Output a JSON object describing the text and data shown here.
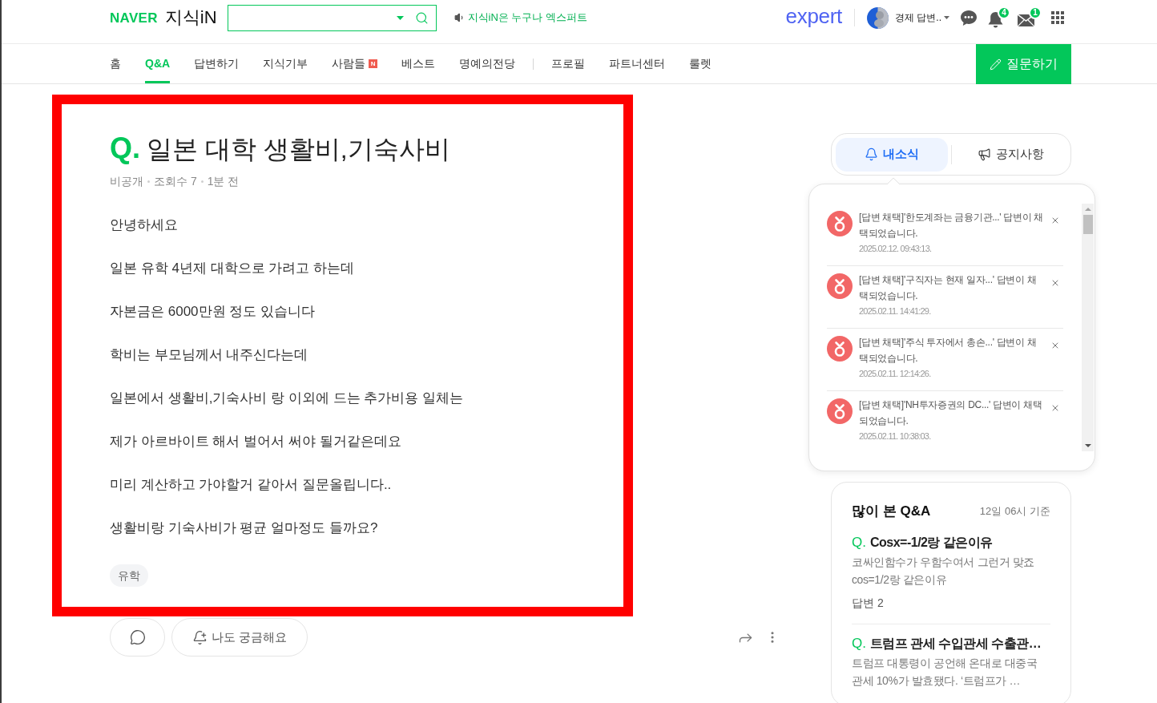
{
  "header": {
    "brand_logo": "NAVER",
    "service_logo": "지식iN",
    "notice_link": "지식iN은 누구나 엑스퍼트",
    "expert_logo": "expert",
    "user_name": "경제 답변..",
    "notifications_badge": "4",
    "mail_badge": "1"
  },
  "nav": {
    "groups": [
      {
        "items": [
          {
            "label": "홈",
            "selected": false
          },
          {
            "label": "Q&A",
            "selected": true
          },
          {
            "label": "답변하기",
            "selected": false
          },
          {
            "label": "지식기부",
            "selected": false
          },
          {
            "label": "사람들",
            "selected": false,
            "badge": "N"
          },
          {
            "label": "베스트",
            "selected": false
          },
          {
            "label": "명예의전당",
            "selected": false
          }
        ]
      },
      {
        "items": [
          {
            "label": "프로필",
            "selected": false
          },
          {
            "label": "파트너센터",
            "selected": false
          },
          {
            "label": "룰렛",
            "selected": false
          }
        ]
      }
    ],
    "ask_button": "질문하기"
  },
  "question": {
    "mark": "Q.",
    "title": "일본 대학 생활비,기숙사비",
    "meta": [
      "비공개",
      "조회수 7",
      "1분 전"
    ],
    "paragraphs": [
      "안녕하세요",
      "일본 유학 4년제 대학으로 가려고 하는데",
      "자본금은 6000만원 정도 있습니다",
      "학비는 부모님께서 내주신다는데",
      "일본에서 생활비,기숙사비 랑 이외에 드는 추가비용 일체는",
      "제가 아르바이트 해서 벌어서 써야 될거같은데요",
      "미리 계산하고 가야할거 같아서 질문올립니다..",
      "생활비랑 기숙사비가 평균 얼마정도 들까요?"
    ],
    "tags": [
      "유학"
    ]
  },
  "question_actions": {
    "curious_button": "나도 궁금해요"
  },
  "sidebar": {
    "tabs": [
      {
        "label": "내소식",
        "selected": true
      },
      {
        "label": "공지사항",
        "selected": false
      }
    ],
    "notifications": [
      {
        "text": "[답변 채택]'한도계좌는 금융기관...' 답변이 채택되었습니다.",
        "time": "2025.02.12. 09:43:13."
      },
      {
        "text": "[답변 채택]'구직자는 현재 일자...' 답변이 채택되었습니다.",
        "time": "2025.02.11. 14:41:29."
      },
      {
        "text": "[답변 채택]'주식 투자에서 총손...' 답변이 채택되었습니다.",
        "time": "2025.02.11. 12:14:26."
      },
      {
        "text": "[답변 채택]'NH투자증권의 DC...' 답변이 채택되었습니다.",
        "time": "2025.02.11. 10:38:03."
      }
    ],
    "popular": {
      "title": "많이 본 Q&A",
      "basis": "12일 06시 기준",
      "items": [
        {
          "mark": "Q.",
          "title": "Cosx=-1/2랑 같은이유",
          "summary": "코싸인함수가 우함수여서 그런거 맞죠 cos=1/2랑 같은이유",
          "answers": "답변 2"
        },
        {
          "mark": "Q.",
          "title": "트럼프 관세 수입관세 수출관…",
          "summary": "트럼프 대통령이 공언해 온대로 대중국 관세 10%가 발효됐다. ‘트럼프가 …"
        }
      ]
    }
  }
}
